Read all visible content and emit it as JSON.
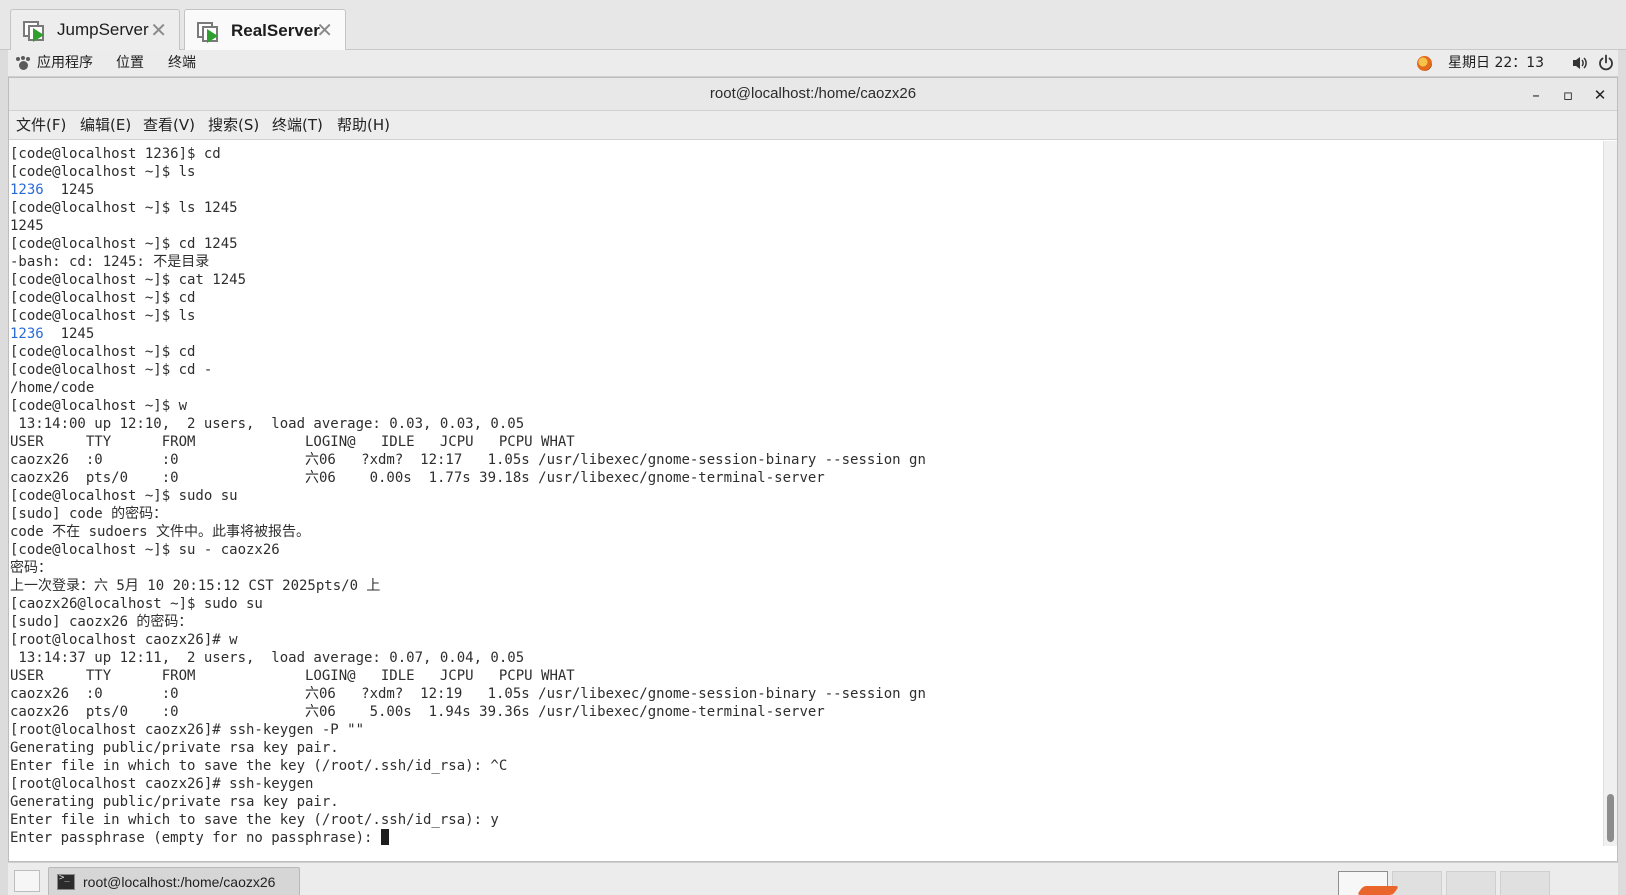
{
  "vm_tabs": [
    {
      "label": "JumpServer",
      "active": false
    },
    {
      "label": "RealServer",
      "active": true
    }
  ],
  "tab_close_glyph": "✕",
  "top_panel": {
    "applications": "应用程序",
    "places": "位置",
    "terminal": "终端",
    "clock": "星期日 22：13"
  },
  "window": {
    "title": "root@localhost:/home/caozx26",
    "minimize_glyph": "–",
    "maximize_glyph": "▫",
    "close_glyph": "✕"
  },
  "menu": [
    "文件(F)",
    "编辑(E)",
    "查看(V)",
    "搜索(S)",
    "终端(T)",
    "帮助(H)"
  ],
  "terminal_lines": [
    "[code@localhost 1236]$ cd",
    "[code@localhost ~]$ ls",
    "",
    "[code@localhost ~]$ ls 1245",
    "1245",
    "[code@localhost ~]$ cd 1245",
    "-bash: cd: 1245: 不是目录",
    "[code@localhost ~]$ cat 1245",
    "[code@localhost ~]$ cd",
    "[code@localhost ~]$ ls",
    "",
    "[code@localhost ~]$ cd",
    "[code@localhost ~]$ cd -",
    "/home/code",
    "[code@localhost ~]$ w",
    " 13:14:00 up 12:10,  2 users,  load average: 0.03, 0.03, 0.05",
    "USER     TTY      FROM             LOGIN@   IDLE   JCPU   PCPU WHAT",
    "caozx26  :0       :0               六06   ?xdm?  12:17   1.05s /usr/libexec/gnome-session-binary --session gn",
    "caozx26  pts/0    :0               六06    0.00s  1.77s 39.18s /usr/libexec/gnome-terminal-server",
    "[code@localhost ~]$ sudo su",
    "[sudo] code 的密码：",
    "code 不在 sudoers 文件中。此事将被报告。",
    "[code@localhost ~]$ su - caozx26",
    "密码：",
    "上一次登录：六 5月 10 20:15:12 CST 2025pts/0 上",
    "[caozx26@localhost ~]$ sudo su",
    "[sudo] caozx26 的密码：",
    "[root@localhost caozx26]# w",
    " 13:14:37 up 12:11,  2 users,  load average: 0.07, 0.04, 0.05",
    "USER     TTY      FROM             LOGIN@   IDLE   JCPU   PCPU WHAT",
    "caozx26  :0       :0               六06   ?xdm?  12:19   1.05s /usr/libexec/gnome-session-binary --session gn",
    "caozx26  pts/0    :0               六06    5.00s  1.94s 39.36s /usr/libexec/gnome-terminal-server",
    "[root@localhost caozx26]# ssh-keygen -P \"\"",
    "Generating public/private rsa key pair.",
    "Enter file in which to save the key (/root/.ssh/id_rsa): ^C",
    "[root@localhost caozx26]# ssh-keygen",
    "Generating public/private rsa key pair.",
    "Enter file in which to save the key (/root/.ssh/id_rsa): y",
    "Enter passphrase (empty for no passphrase): "
  ],
  "ls_output": {
    "dir": "1236",
    "file": "  1245"
  },
  "taskbar": {
    "task_label": "root@localhost:/home/caozx26"
  },
  "colors": {
    "directory": "#2a6bd6",
    "accent_arrow": "#e9652b",
    "play_green": "#2fa02f"
  }
}
